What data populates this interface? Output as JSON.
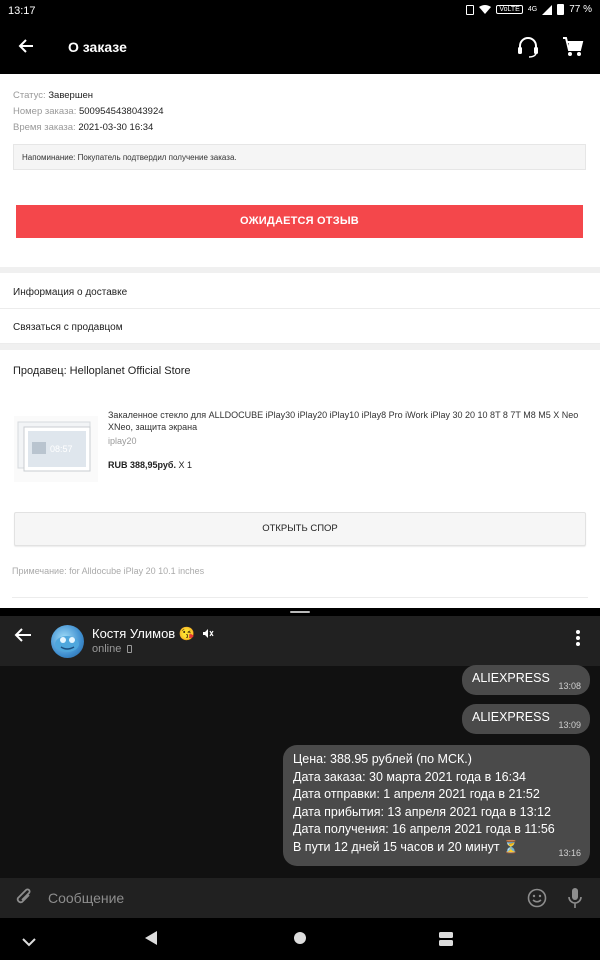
{
  "status_bar": {
    "time": "13:17",
    "volte": "VoLTE",
    "network": "4G",
    "battery": "77 %"
  },
  "app_header": {
    "title": "О заказе",
    "icons": [
      "back-arrow-icon",
      "support-headset-icon",
      "cart-icon"
    ]
  },
  "order": {
    "status_label": "Статус:",
    "status_value": "Завершен",
    "number_label": "Номер заказа:",
    "number_value": "5009545438043924",
    "time_label": "Время заказа:",
    "time_value": "2021-03-30 16:34",
    "reminder": "Напоминание: Покупатель подтвердил получение заказа.",
    "review_button": "ОЖИДАЕТСЯ ОТЗЫВ",
    "delivery_info": "Информация о доставке",
    "contact_seller": "Связаться с продавцом",
    "seller": "Продавец: Helloplanet Official Store",
    "product": {
      "title": "Закаленное стекло для ALLDOCUBE iPlay30 iPlay20 iPlay10 iPlay8 Pro iWork iPlay 30 20 10 8T 8 7T M8 M5 X Neo XNeo, защита экрана",
      "sku": "iplay20",
      "price": "RUB 388,95руб.",
      "qty": "X 1",
      "thumb_time": "08:57"
    },
    "dispute_button": "ОТКРЫТЬ СПОР",
    "note": "Примечание: for Alldocube iPlay 20 10.1 inches"
  },
  "telegram": {
    "contact_name": "Костя Улимов 😘",
    "contact_status": "online",
    "messages": [
      {
        "text": "ALIEXPRESS",
        "time": "13:08"
      },
      {
        "text": "ALIEXPRESS",
        "time": "13:09"
      },
      {
        "lines": [
          "Цена: 388.95 рублей (по МСК.)",
          "Дата заказа: 30 марта 2021 года в 16:34",
          "Дата отправки: 1 апреля 2021 года в 21:52",
          "Дата прибытия: 13 апреля 2021 года в 13:12",
          "Дата получения: 16 апреля 2021 года в 11:56",
          "В пути 12 дней 15 часов и 20 минут ⏳"
        ],
        "time": "13:16"
      }
    ],
    "input_placeholder": "Сообщение"
  },
  "colors": {
    "accent_red": "#f4474b",
    "chat_bubble": "#4a4a4a",
    "chat_bg": "#111111"
  }
}
